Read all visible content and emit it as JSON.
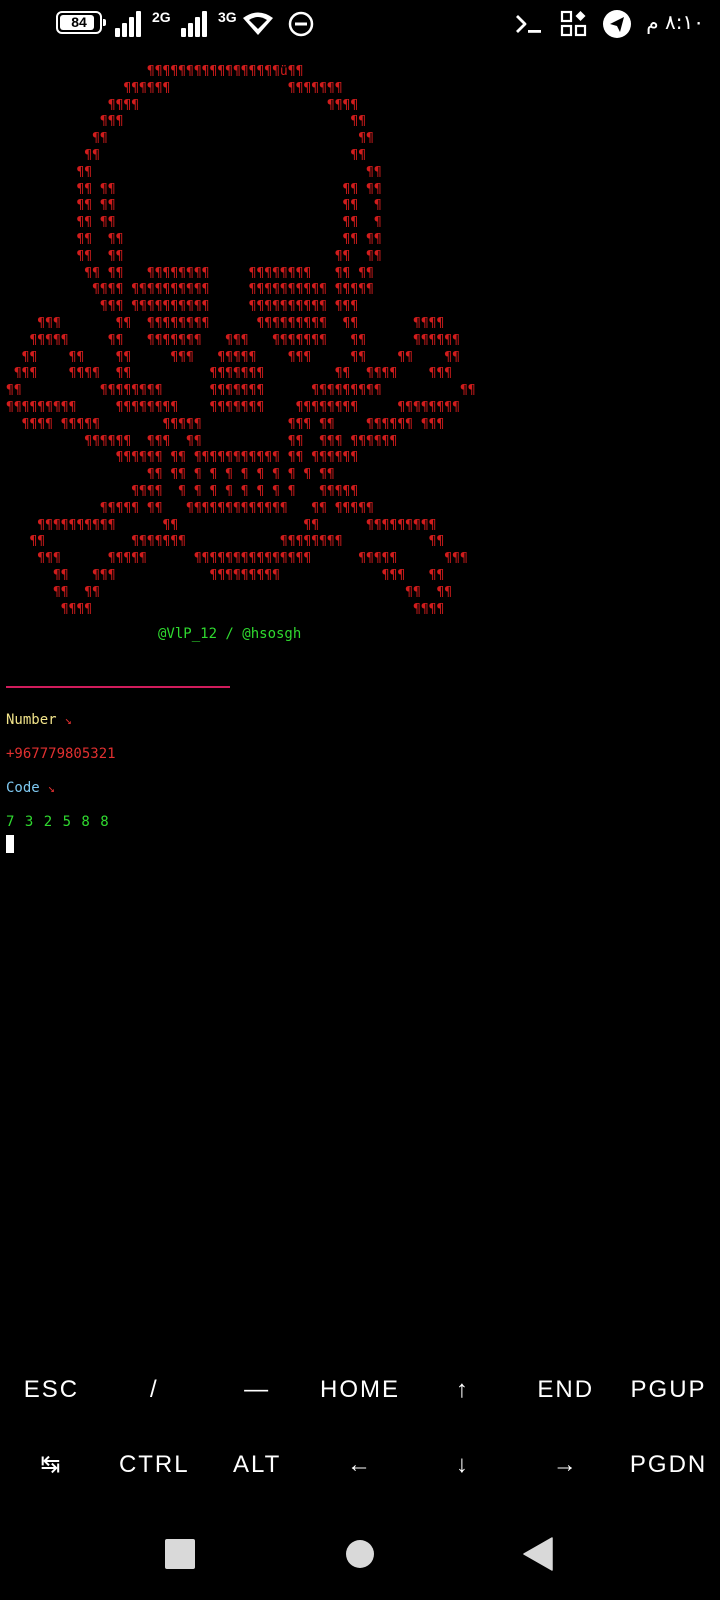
{
  "status_bar": {
    "battery_level": "84",
    "network_1": "2G",
    "network_2": "3G",
    "icons": [
      "battery-icon",
      "signal-icon",
      "signal-icon",
      "wifi-icon",
      "do-not-disturb-icon",
      "terminal-icon",
      "apps-icon",
      "telegram-icon"
    ],
    "time": "٨:١٠ م"
  },
  "terminal": {
    "ascii_art": "                  ¶¶¶¶¶¶¶¶¶¶¶¶¶¶¶¶¶ü¶¶\n               ¶¶¶¶¶¶               ¶¶¶¶¶¶¶\n             ¶¶¶¶                        ¶¶¶¶\n            ¶¶¶                             ¶¶\n           ¶¶                                ¶¶\n          ¶¶                                ¶¶\n         ¶¶                                   ¶¶\n         ¶¶ ¶¶                             ¶¶ ¶¶\n         ¶¶ ¶¶                             ¶¶  ¶\n         ¶¶ ¶¶                             ¶¶  ¶\n         ¶¶  ¶¶                            ¶¶ ¶¶\n         ¶¶  ¶¶                           ¶¶  ¶¶\n          ¶¶ ¶¶   ¶¶¶¶¶¶¶¶     ¶¶¶¶¶¶¶¶   ¶¶ ¶¶\n           ¶¶¶¶ ¶¶¶¶¶¶¶¶¶¶     ¶¶¶¶¶¶¶¶¶¶ ¶¶¶¶¶\n            ¶¶¶ ¶¶¶¶¶¶¶¶¶¶     ¶¶¶¶¶¶¶¶¶¶ ¶¶¶\n    ¶¶¶       ¶¶  ¶¶¶¶¶¶¶¶      ¶¶¶¶¶¶¶¶¶  ¶¶       ¶¶¶¶\n   ¶¶¶¶¶     ¶¶   ¶¶¶¶¶¶¶   ¶¶¶   ¶¶¶¶¶¶¶   ¶¶      ¶¶¶¶¶¶\n  ¶¶    ¶¶    ¶¶     ¶¶¶   ¶¶¶¶¶    ¶¶¶     ¶¶    ¶¶    ¶¶\n ¶¶¶    ¶¶¶¶  ¶¶          ¶¶¶¶¶¶¶         ¶¶  ¶¶¶¶    ¶¶¶\n¶¶          ¶¶¶¶¶¶¶¶      ¶¶¶¶¶¶¶      ¶¶¶¶¶¶¶¶¶          ¶¶\n¶¶¶¶¶¶¶¶¶     ¶¶¶¶¶¶¶¶    ¶¶¶¶¶¶¶    ¶¶¶¶¶¶¶¶     ¶¶¶¶¶¶¶¶\n  ¶¶¶¶ ¶¶¶¶¶        ¶¶¶¶¶           ¶¶¶ ¶¶    ¶¶¶¶¶¶ ¶¶¶\n          ¶¶¶¶¶¶  ¶¶¶  ¶¶           ¶¶  ¶¶¶ ¶¶¶¶¶¶\n              ¶¶¶¶¶¶ ¶¶ ¶¶¶¶¶¶¶¶¶¶¶ ¶¶ ¶¶¶¶¶¶\n                  ¶¶ ¶¶ ¶ ¶ ¶ ¶ ¶ ¶ ¶ ¶ ¶¶\n                ¶¶¶¶  ¶ ¶ ¶ ¶ ¶ ¶ ¶ ¶   ¶¶¶¶¶\n            ¶¶¶¶¶ ¶¶   ¶¶¶¶¶¶¶¶¶¶¶¶¶   ¶¶ ¶¶¶¶¶\n    ¶¶¶¶¶¶¶¶¶¶      ¶¶                ¶¶      ¶¶¶¶¶¶¶¶¶\n   ¶¶           ¶¶¶¶¶¶¶            ¶¶¶¶¶¶¶¶           ¶¶\n    ¶¶¶      ¶¶¶¶¶      ¶¶¶¶¶¶¶¶¶¶¶¶¶¶¶      ¶¶¶¶¶      ¶¶¶\n      ¶¶   ¶¶¶            ¶¶¶¶¶¶¶¶¶             ¶¶¶   ¶¶\n      ¶¶  ¶¶                                       ¶¶  ¶¶\n       ¶¶¶¶                                         ¶¶¶¶",
    "handle": "@VlP_12 / @hsosgh",
    "number_label": "Number",
    "number_arrow": "↘",
    "number_value": "+967779805321",
    "code_label": "Code",
    "code_arrow": "↘",
    "code_value": "7 3 2 5 8 8"
  },
  "extra_keys": {
    "row1": [
      "ESC",
      "/",
      "—",
      "HOME",
      "↑",
      "END",
      "PGUP"
    ],
    "row2": [
      "↹",
      "CTRL",
      "ALT",
      "←",
      "↓",
      "→",
      "PGDN"
    ]
  },
  "nav_bar": {
    "icons": [
      "recents-square-icon",
      "home-circle-icon",
      "back-triangle-icon"
    ]
  }
}
